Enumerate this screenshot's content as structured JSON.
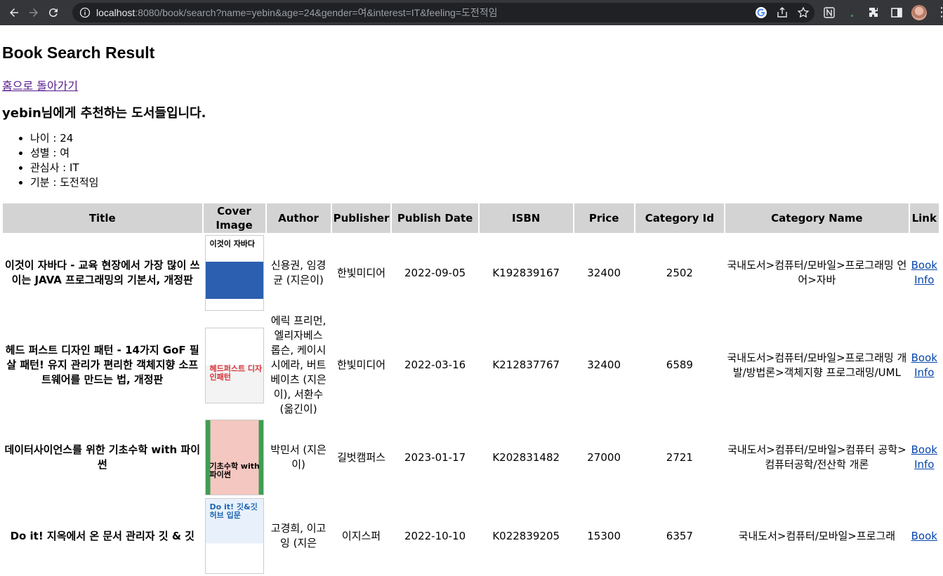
{
  "browser": {
    "url_host": "localhost",
    "url_rest": ":8080/book/search?name=yebin&age=24&gender=여&interest=IT&feeling=도전적임"
  },
  "page": {
    "title": "Book Search Result",
    "home_link": "홈으로 돌아가기",
    "recommend_heading": "yebin님에게 추천하는 도서들입니다.",
    "info": [
      "나이 : 24",
      "성별 : 여",
      "관심사 : IT",
      "기분 : 도전적임"
    ]
  },
  "table": {
    "headers": {
      "title": "Title",
      "cover": "Cover Image",
      "author": "Author",
      "publisher": "Publisher",
      "date": "Publish Date",
      "isbn": "ISBN",
      "price": "Price",
      "category_id": "Category Id",
      "category_name": "Category Name",
      "link": "Link"
    },
    "rows": [
      {
        "title": "이것이 자바다 - 교육 현장에서 가장 많이 쓰이는 JAVA 프로그래밍의 기본서, 개정판",
        "cover_text": "이것이 자바다",
        "cover_color": "#2d5fb0",
        "author": "신용권, 임경균 (지은이)",
        "publisher": "한빛미디어",
        "date": "2022-09-05",
        "isbn": "K192839167",
        "price": "32400",
        "category_id": "2502",
        "category_name": "국내도서>컴퓨터/모바일>프로그래밍 언어>자바",
        "link": "Book Info"
      },
      {
        "title": "헤드 퍼스트 디자인 패턴 - 14가지 GoF 필살 패턴! 유지 관리가 편리한 객체지향 소프트웨어를 만드는 법, 개정판",
        "cover_text": "헤드퍼스트 디자인패턴",
        "cover_color": "#d9343a",
        "author": "에릭 프리먼, 엘리자베스 롭슨, 케이시 시에라, 버트 베이츠 (지은이), 서환수 (옮긴이)",
        "publisher": "한빛미디어",
        "date": "2022-03-16",
        "isbn": "K212837767",
        "price": "32400",
        "category_id": "6589",
        "category_name": "국내도서>컴퓨터/모바일>프로그래밍 개발/방법론>객체지향 프로그래밍/UML",
        "link": "Book Info"
      },
      {
        "title": "데이터사이언스를 위한 기초수학 with 파이썬",
        "cover_text": "기초수학 with 파이썬",
        "cover_color": "#3f9d53",
        "author": "박민서 (지은이)",
        "publisher": "길벗캠퍼스",
        "date": "2023-01-17",
        "isbn": "K202831482",
        "price": "27000",
        "category_id": "2721",
        "category_name": "국내도서>컴퓨터/모바일>컴퓨터 공학>컴퓨터공학/전산학 개론",
        "link": "Book Info"
      },
      {
        "title": "Do it! 지옥에서 온 문서 관리자 깃 & 깃",
        "cover_text": "Do it! 깃&깃허브 입문",
        "cover_color": "#1f66b1",
        "author": "고경희, 이고잉 (지은",
        "publisher": "이지스퍼",
        "date": "2022-10-10",
        "isbn": "K022839205",
        "price": "15300",
        "category_id": "6357",
        "category_name": "국내도서>컴퓨터/모바일>프로그래",
        "link": "Book"
      }
    ]
  },
  "colors": {
    "chrome_bg": "#35363a",
    "omnibox_bg": "#202124",
    "header_bg": "#d3d3d3",
    "visited_link": "#551a8b",
    "link": "#0645ad"
  }
}
